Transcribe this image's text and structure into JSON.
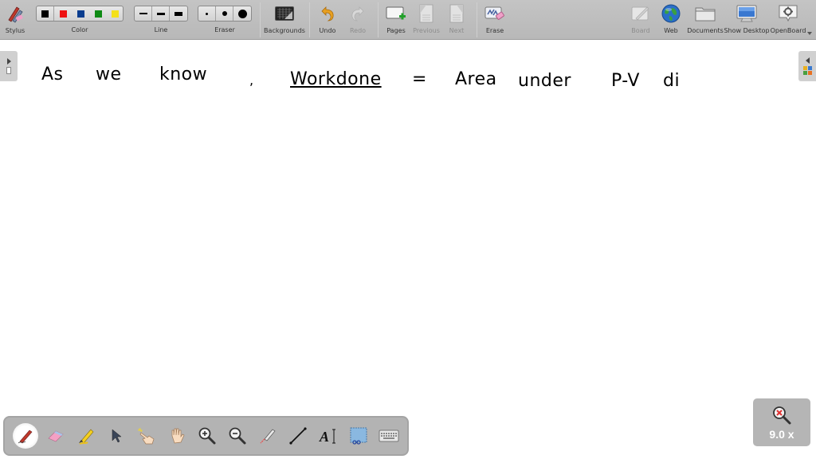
{
  "toolbar": {
    "stylus": {
      "label": "Stylus",
      "icon": "stylus-icon"
    },
    "color": {
      "label": "Color",
      "options": [
        "#000000",
        "#ee1111",
        "#0a3d8f",
        "#0e8a14",
        "#f4e01a"
      ],
      "selected": 0
    },
    "line": {
      "label": "Line",
      "options": [
        "thin",
        "medium",
        "thick"
      ]
    },
    "eraser": {
      "label": "Eraser",
      "options": [
        "small",
        "medium",
        "large"
      ]
    },
    "backgrounds": {
      "label": "Backgrounds",
      "icon": "backgrounds-icon"
    },
    "undo": {
      "label": "Undo",
      "icon": "undo-icon",
      "enabled": true
    },
    "redo": {
      "label": "Redo",
      "icon": "redo-icon",
      "enabled": false
    },
    "pages": {
      "label": "Pages",
      "icon": "add-page-icon"
    },
    "previous": {
      "label": "Previous",
      "icon": "previous-page-icon",
      "enabled": false
    },
    "next": {
      "label": "Next",
      "icon": "next-page-icon",
      "enabled": false
    },
    "erase": {
      "label": "Erase",
      "icon": "erase-icon"
    },
    "board": {
      "label": "Board",
      "icon": "board-icon",
      "enabled": false
    },
    "web": {
      "label": "Web",
      "icon": "globe-icon"
    },
    "documents": {
      "label": "Documents",
      "icon": "folder-icon"
    },
    "show_desktop": {
      "label": "Show Desktop",
      "icon": "monitor-icon"
    },
    "openboard": {
      "label": "OpenBoard",
      "icon": "settings-icon"
    }
  },
  "board": {
    "handwriting": [
      {
        "text": "As"
      },
      {
        "text": "we"
      },
      {
        "text": "know"
      },
      {
        "text": ","
      },
      {
        "text": "Workdone"
      },
      {
        "text": "="
      },
      {
        "text": "Area"
      },
      {
        "text": "under"
      },
      {
        "text": "P-V"
      },
      {
        "text": "di"
      }
    ]
  },
  "palette": {
    "tools": [
      {
        "name": "pen",
        "active": true
      },
      {
        "name": "eraser"
      },
      {
        "name": "marker"
      },
      {
        "name": "selector"
      },
      {
        "name": "play"
      },
      {
        "name": "hand"
      },
      {
        "name": "zoom-in"
      },
      {
        "name": "zoom-out"
      },
      {
        "name": "laser-pointer"
      },
      {
        "name": "line"
      },
      {
        "name": "text"
      },
      {
        "name": "capture"
      },
      {
        "name": "virtual-keyboard"
      }
    ]
  },
  "zoom": {
    "value": "9.0 x"
  }
}
